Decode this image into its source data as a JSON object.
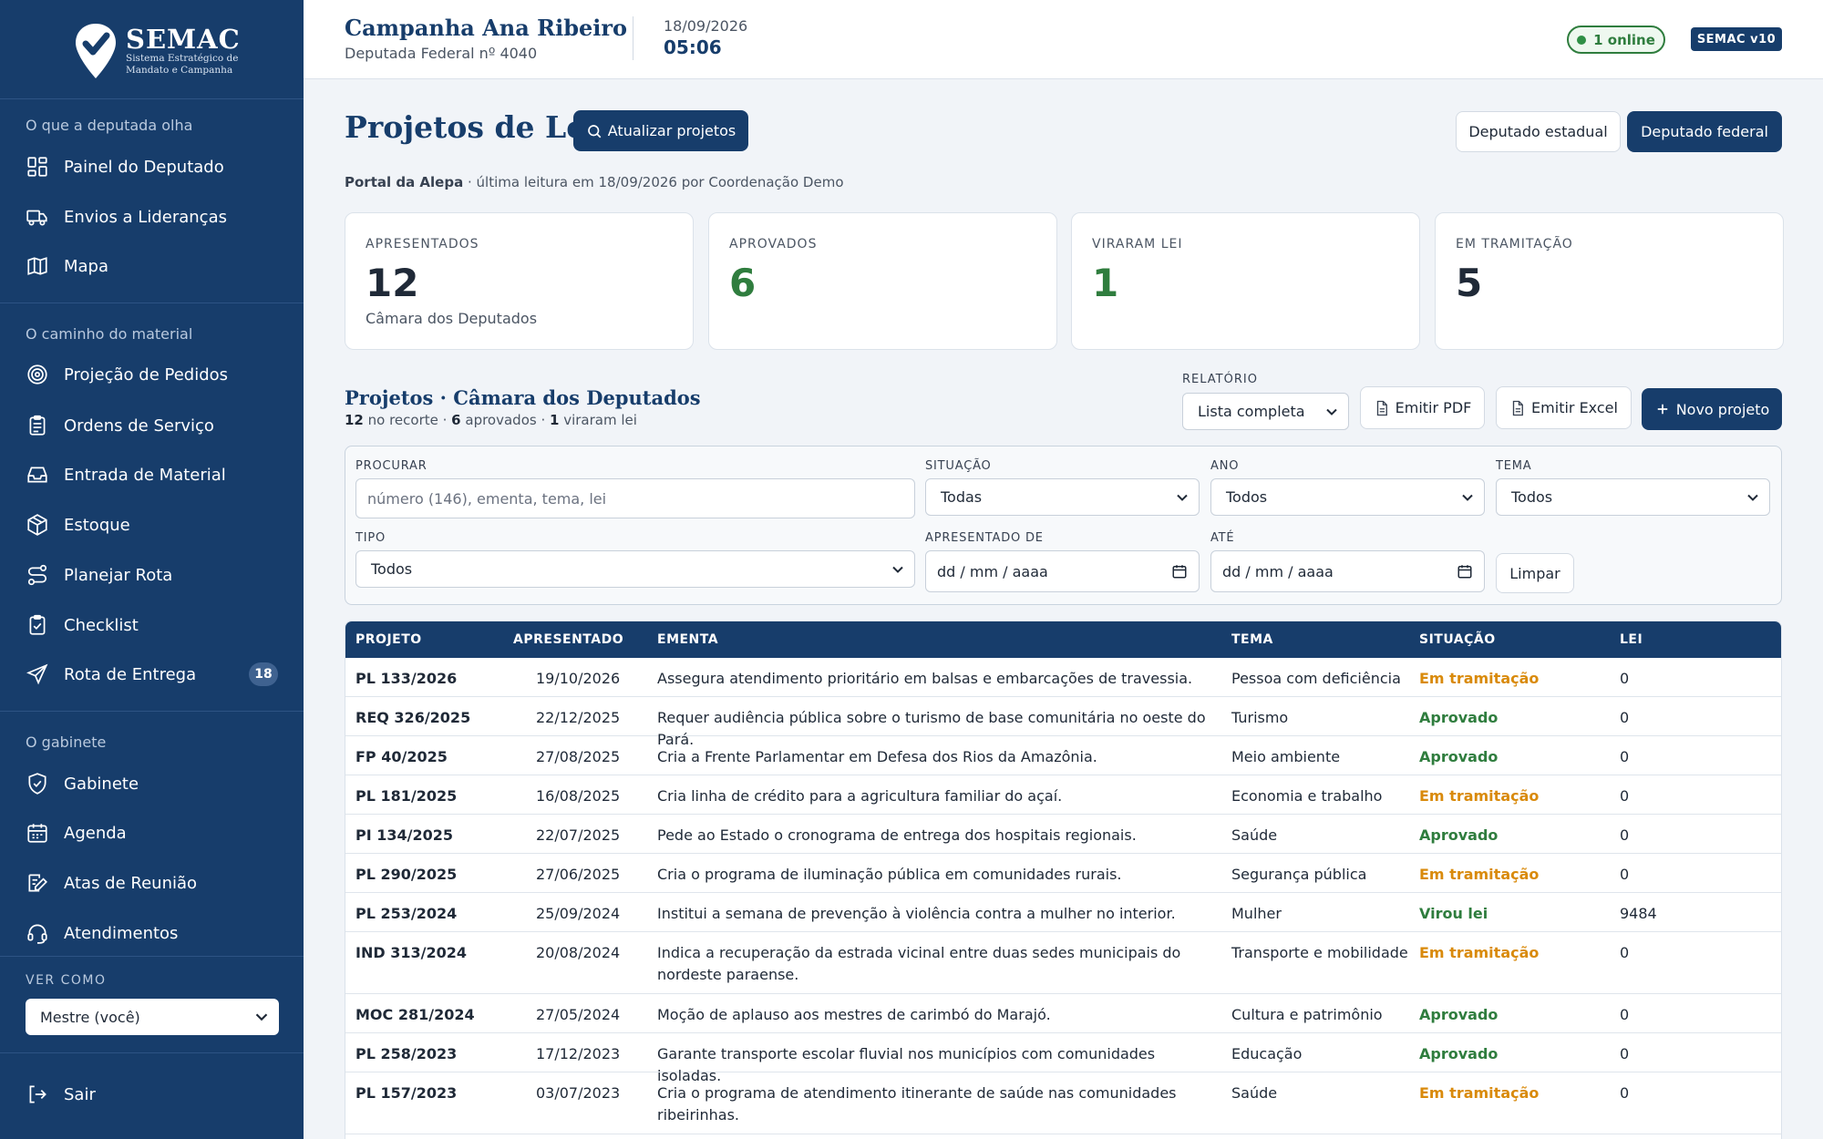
{
  "brand": {
    "name": "SEMAC",
    "sub1": "Sistema Estratégico de",
    "sub2": "Mandato e Campanha"
  },
  "sidebar": {
    "sections": [
      {
        "label": "O que a deputada olha"
      },
      {
        "label": "O caminho do material"
      },
      {
        "label": "O gabinete"
      }
    ],
    "items": [
      {
        "label": "Painel do Deputado",
        "icon": "dashboard-icon"
      },
      {
        "label": "Envios a Lideranças",
        "icon": "truck-icon"
      },
      {
        "label": "Mapa",
        "icon": "map-icon"
      },
      {
        "label": "Projeção de Pedidos",
        "icon": "target-icon"
      },
      {
        "label": "Ordens de Serviço",
        "icon": "clipboard-icon"
      },
      {
        "label": "Entrada de Material",
        "icon": "inbox-icon"
      },
      {
        "label": "Estoque",
        "icon": "package-icon"
      },
      {
        "label": "Planejar Rota",
        "icon": "route-icon"
      },
      {
        "label": "Checklist",
        "icon": "clipboard-check-icon"
      },
      {
        "label": "Rota de Entrega",
        "icon": "send-icon",
        "badge": "18"
      },
      {
        "label": "Gabinete",
        "icon": "shield-icon"
      },
      {
        "label": "Agenda",
        "icon": "calendar-icon"
      },
      {
        "label": "Atas de Reunião",
        "icon": "edit-icon"
      },
      {
        "label": "Atendimentos",
        "icon": "headset-icon"
      }
    ],
    "ver_como_label": "VER COMO",
    "ver_como_value": "Mestre (você)",
    "logout_label": "Sair"
  },
  "header": {
    "title": "Campanha Ana Ribeiro",
    "subtitle": "Deputada Federal nº 4040",
    "date": "18/09/2026",
    "time": "05:06",
    "online": "1 online",
    "version": "SEMAC v10"
  },
  "main": {
    "title": "Projetos de Lei",
    "refresh_label": "Atualizar projetos",
    "toggle_estadual": "Deputado estadual",
    "toggle_federal": "Deputado federal",
    "source_bold": "Portal da Alepa",
    "source_rest": " · última leitura em 18/09/2026 por Coordenação Demo",
    "stats": [
      {
        "label": "APRESENTADOS",
        "value": "12",
        "sub": "Câmara dos Deputados"
      },
      {
        "label": "APROVADOS",
        "value": "6",
        "sub": ""
      },
      {
        "label": "VIRARAM LEI",
        "value": "1",
        "sub": ""
      },
      {
        "label": "EM TRAMITAÇÃO",
        "value": "5",
        "sub": ""
      }
    ],
    "section_title": "Projetos · Câmara dos Deputados",
    "section_sub": {
      "n1": "12",
      "t1": " no recorte · ",
      "n2": "6",
      "t2": " aprovados · ",
      "n3": "1",
      "t3": " viraram lei"
    },
    "report_label": "RELATÓRIO",
    "report_value": "Lista completa",
    "pdf_label": "Emitir PDF",
    "excel_label": "Emitir Excel",
    "new_label": "Novo projeto"
  },
  "filters": {
    "search_label": "PROCURAR",
    "search_placeholder": "número (146), ementa, tema, lei",
    "situacao_label": "SITUAÇÃO",
    "situacao_value": "Todas",
    "ano_label": "ANO",
    "ano_value": "Todos",
    "tema_label": "TEMA",
    "tema_value": "Todos",
    "tipo_label": "TIPO",
    "tipo_value": "Todos",
    "de_label": "APRESENTADO DE",
    "de_value": "dd / mm / aaaa",
    "ate_label": "ATÉ",
    "ate_value": "dd / mm / aaaa",
    "clear_label": "Limpar"
  },
  "table": {
    "headers": [
      "PROJETO",
      "APRESENTADO",
      "EMENTA",
      "TEMA",
      "SITUAÇÃO",
      "LEI"
    ],
    "rows": [
      {
        "projeto": "PL 133/2026",
        "apresentado": "19/10/2026",
        "ementa": "Assegura atendimento prioritário em balsas e embarcações de travessia.",
        "tema": "Pessoa com deficiência",
        "situacao": "Em tramitação",
        "lei": "0"
      },
      {
        "projeto": "REQ 326/2025",
        "apresentado": "22/12/2025",
        "ementa": "Requer audiência pública sobre o turismo de base comunitária no oeste do Pará.",
        "tema": "Turismo",
        "situacao": "Aprovado",
        "lei": "0"
      },
      {
        "projeto": "FP 40/2025",
        "apresentado": "27/08/2025",
        "ementa": "Cria a Frente Parlamentar em Defesa dos Rios da Amazônia.",
        "tema": "Meio ambiente",
        "situacao": "Aprovado",
        "lei": "0"
      },
      {
        "projeto": "PL 181/2025",
        "apresentado": "16/08/2025",
        "ementa": "Cria linha de crédito para a agricultura familiar do açaí.",
        "tema": "Economia e trabalho",
        "situacao": "Em tramitação",
        "lei": "0"
      },
      {
        "projeto": "PI 134/2025",
        "apresentado": "22/07/2025",
        "ementa": "Pede ao Estado o cronograma de entrega dos hospitais regionais.",
        "tema": "Saúde",
        "situacao": "Aprovado",
        "lei": "0"
      },
      {
        "projeto": "PL 290/2025",
        "apresentado": "27/06/2025",
        "ementa": "Cria o programa de iluminação pública em comunidades rurais.",
        "tema": "Segurança pública",
        "situacao": "Em tramitação",
        "lei": "0"
      },
      {
        "projeto": "PL 253/2024",
        "apresentado": "25/09/2024",
        "ementa": "Institui a semana de prevenção à violência contra a mulher no interior.",
        "tema": "Mulher",
        "situacao": "Virou lei",
        "lei": "9484"
      },
      {
        "projeto": "IND 313/2024",
        "apresentado": "20/08/2024",
        "ementa": "Indica a recuperação da estrada vicinal entre duas sedes municipais do nordeste paraense.",
        "tema": "Transporte e mobilidade",
        "situacao": "Em tramitação",
        "lei": "0"
      },
      {
        "projeto": "MOC 281/2024",
        "apresentado": "27/05/2024",
        "ementa": "Moção de aplauso aos mestres de carimbó do Marajó.",
        "tema": "Cultura e patrimônio",
        "situacao": "Aprovado",
        "lei": "0"
      },
      {
        "projeto": "PL 258/2023",
        "apresentado": "17/12/2023",
        "ementa": "Garante transporte escolar fluvial nos municípios com comunidades isoladas.",
        "tema": "Educação",
        "situacao": "Aprovado",
        "lei": "0"
      },
      {
        "projeto": "PL 157/2023",
        "apresentado": "03/07/2023",
        "ementa": "Cria o programa de atendimento itinerante de saúde nas comunidades ribeirinhas.",
        "tema": "Saúde",
        "situacao": "Em tramitação",
        "lei": "0"
      }
    ]
  },
  "colors": {
    "navy": "#173d6b",
    "green": "#2f7d3e",
    "orange": "#d98a0b"
  }
}
